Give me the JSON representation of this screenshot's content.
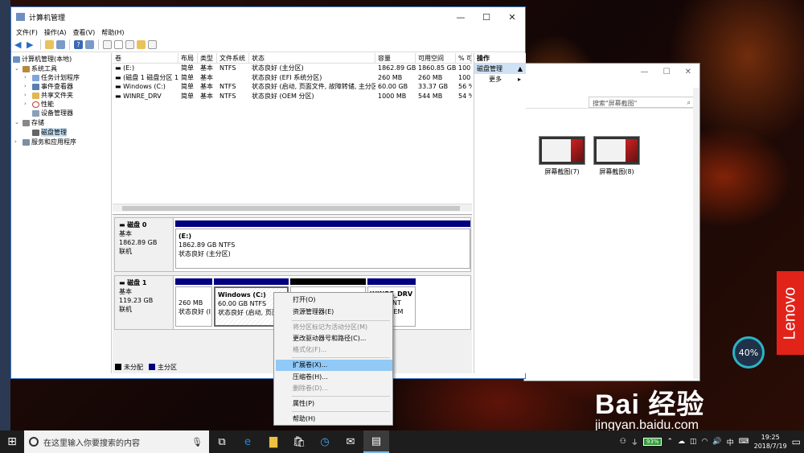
{
  "window": {
    "title": "计算机管理",
    "controls": {
      "minimize": "—",
      "maximize": "☐",
      "close": "✕"
    }
  },
  "menu": [
    "文件(F)",
    "操作(A)",
    "查看(V)",
    "帮助(H)"
  ],
  "tree": {
    "root": "计算机管理(本地)",
    "system_tools": "系统工具",
    "task_scheduler": "任务计划程序",
    "event_viewer": "事件查看器",
    "shared_folders": "共享文件夹",
    "performance": "性能",
    "device_manager": "设备管理器",
    "storage": "存储",
    "disk_management": "磁盘管理",
    "services": "服务和应用程序"
  },
  "volume_columns": [
    "卷",
    "布局",
    "类型",
    "文件系统",
    "状态",
    "容量",
    "可用空间",
    "% 可"
  ],
  "volumes": [
    {
      "name": "(E:)",
      "layout": "简单",
      "type": "基本",
      "fs": "NTFS",
      "status": "状态良好 (主分区)",
      "capacity": "1862.89 GB",
      "free": "1860.85 GB",
      "pct": "100"
    },
    {
      "name": "(磁盘 1 磁盘分区 1)",
      "layout": "简单",
      "type": "基本",
      "fs": "",
      "status": "状态良好 (EFI 系统分区)",
      "capacity": "260 MB",
      "free": "260 MB",
      "pct": "100"
    },
    {
      "name": "Windows (C:)",
      "layout": "简单",
      "type": "基本",
      "fs": "NTFS",
      "status": "状态良好 (启动, 页面文件, 故障转储, 主分区)",
      "capacity": "60.00 GB",
      "free": "33.37 GB",
      "pct": "56 %"
    },
    {
      "name": "WINRE_DRV",
      "layout": "简单",
      "type": "基本",
      "fs": "NTFS",
      "status": "状态良好 (OEM 分区)",
      "capacity": "1000 MB",
      "free": "544 MB",
      "pct": "54 %"
    }
  ],
  "disk0": {
    "name": "磁盘 0",
    "type": "基本",
    "size": "1862.89 GB",
    "state": "联机",
    "partition": {
      "label": "(E:)",
      "size": "1862.89 GB NTFS",
      "status": "状态良好 (主分区)"
    }
  },
  "disk1": {
    "name": "磁盘 1",
    "type": "基本",
    "size": "119.23 GB",
    "state": "联机",
    "p1": {
      "size": "260 MB",
      "status": "状态良好 (I"
    },
    "p2": {
      "label": "Windows  (C:)",
      "size": "60.00 GB NTFS",
      "status": "状态良好 (启动, 页面"
    },
    "p4": {
      "label": "WINRE_DRV",
      "size": "B NT",
      "status": "(OEM"
    }
  },
  "legend": {
    "unallocated": "未分配",
    "primary": "主分区"
  },
  "actions": {
    "header": "操作",
    "section": "磁盘管理",
    "more": "更多"
  },
  "context_menu": [
    {
      "label": "打开(O)",
      "disabled": false
    },
    {
      "label": "资源管理器(E)",
      "disabled": false
    },
    {
      "label": "将分区标记为活动分区(M)",
      "disabled": true
    },
    {
      "label": "更改驱动器号和路径(C)...",
      "disabled": false
    },
    {
      "label": "格式化(F)...",
      "disabled": true
    },
    {
      "label": "扩展卷(X)...",
      "disabled": false,
      "highlighted": true
    },
    {
      "label": "压缩卷(H)...",
      "disabled": false
    },
    {
      "label": "删除卷(D)...",
      "disabled": true
    },
    {
      "label": "属性(P)",
      "disabled": false
    },
    {
      "label": "帮助(H)",
      "disabled": false
    }
  ],
  "explorer": {
    "search_placeholder": "搜索\"屏幕截图\"",
    "thumb1": "屏幕截图(7)",
    "thumb2": "屏幕截图(8)"
  },
  "taskbar": {
    "search_placeholder": "在这里输入你要搜索的内容",
    "battery": "93%",
    "time": "19:25",
    "date": "2018/7/19"
  },
  "overlay": {
    "gauge": "40%",
    "lenovo": "Lenovo",
    "baidu_brand": "Bai 经验",
    "baidu_url": "jingyan.baidu.com"
  }
}
